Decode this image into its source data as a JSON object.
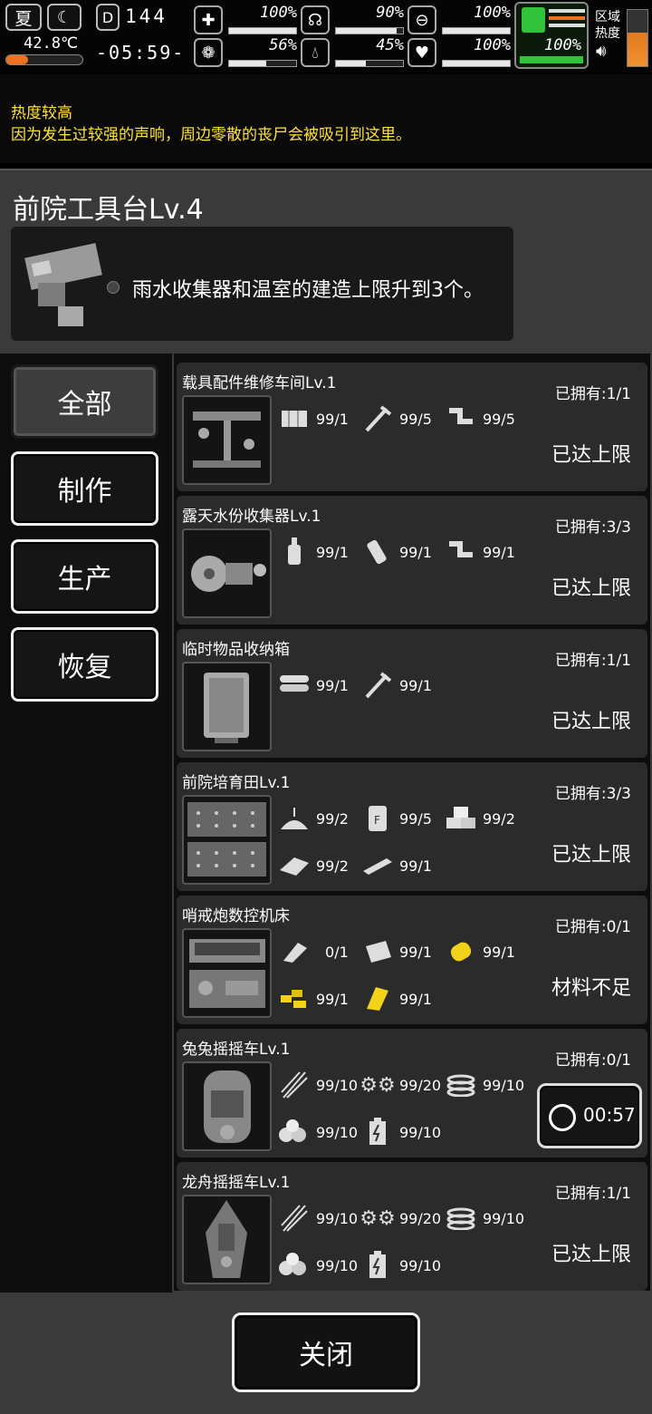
{
  "top": {
    "season": "夏",
    "temperature": "42.8℃",
    "day": "144",
    "clock": "-05:59-",
    "area_heat_label_1": "区域",
    "area_heat_label_2": "热度",
    "stats": [
      {
        "icon": "medkit-icon",
        "pct": "100%",
        "level": 1.0
      },
      {
        "icon": "stomach-icon",
        "pct": "90%",
        "level": 0.9
      },
      {
        "icon": "pill-icon",
        "pct": "100%",
        "level": 1.0
      },
      {
        "icon": "brain-icon",
        "pct": "56%",
        "level": 0.56
      },
      {
        "icon": "water-drop-icon",
        "pct": "45%",
        "level": 0.45
      },
      {
        "icon": "heart-icon",
        "pct": "100%",
        "level": 1.0
      },
      {
        "icon": "battery-icon",
        "pct": "100%",
        "level": 1.0
      }
    ]
  },
  "banner": {
    "title": "热度较高",
    "message": "因为发生过较强的声响，周边零散的丧尸会被吸引到这里。"
  },
  "panel": {
    "title": "前院工具台Lv.4",
    "info": "雨水收集器和温室的建造上限升到3个。"
  },
  "tabs": [
    "全部",
    "制作",
    "生产",
    "恢复"
  ],
  "items": [
    {
      "name": "载具配件维修车间Lv.1",
      "owned": "已拥有:1/1",
      "status": "已达上限",
      "mats": [
        {
          "icon": "wood-plank-icon",
          "have": "99",
          "need": "/1"
        },
        {
          "icon": "nail-icon",
          "have": "99",
          "need": "/5"
        },
        {
          "icon": "pipe-icon",
          "have": "99",
          "need": "/5"
        }
      ]
    },
    {
      "name": "露天水份收集器Lv.1",
      "owned": "已拥有:3/3",
      "status": "已达上限",
      "mats": [
        {
          "icon": "bottle-icon",
          "have": "99",
          "need": "/1"
        },
        {
          "icon": "tape-icon",
          "have": "99",
          "need": "/1"
        },
        {
          "icon": "pipe-icon",
          "have": "99",
          "need": "/1"
        }
      ]
    },
    {
      "name": "临时物品收纳箱",
      "owned": "已拥有:1/1",
      "status": "已达上限",
      "mats": [
        {
          "icon": "logs-icon",
          "have": "99",
          "need": "/1"
        },
        {
          "icon": "nail-icon",
          "have": "99",
          "need": "/1"
        }
      ]
    },
    {
      "name": "前院培育田Lv.1",
      "owned": "已拥有:3/3",
      "status": "已达上限",
      "mats": [
        {
          "icon": "soil-icon",
          "have": "99",
          "need": "/2"
        },
        {
          "icon": "fertilizer-icon",
          "have": "99",
          "need": "/5"
        },
        {
          "icon": "bricks-icon",
          "have": "99",
          "need": "/2"
        },
        {
          "icon": "cloth-icon",
          "have": "99",
          "need": "/2"
        },
        {
          "icon": "metal-sheet-icon",
          "have": "99",
          "need": "/1"
        }
      ]
    },
    {
      "name": "哨戒炮数控机床",
      "owned": "已拥有:0/1",
      "status": "材料不足",
      "mats": [
        {
          "icon": "part-icon",
          "have": "0",
          "need": "/1",
          "short": true
        },
        {
          "icon": "paper-icon",
          "have": "99",
          "need": "/1"
        },
        {
          "icon": "yellow-coil-icon",
          "have": "99",
          "need": "/1"
        },
        {
          "icon": "yellow-parts-icon",
          "have": "99",
          "need": "/1"
        },
        {
          "icon": "yellow-sheet-icon",
          "have": "99",
          "need": "/1"
        }
      ]
    },
    {
      "name": "兔兔摇摇车Lv.1",
      "owned": "已拥有:0/1",
      "timer": "00:57",
      "mats": [
        {
          "icon": "wires-icon",
          "have": "99",
          "need": "/10"
        },
        {
          "icon": "gears-icon",
          "have": "99",
          "need": "/20"
        },
        {
          "icon": "spring-icon",
          "have": "99",
          "need": "/10"
        },
        {
          "icon": "stones-icon",
          "have": "99",
          "need": "/10"
        },
        {
          "icon": "battery-cell-icon",
          "have": "99",
          "need": "/10"
        }
      ]
    },
    {
      "name": "龙舟摇摇车Lv.1",
      "owned": "已拥有:1/1",
      "status": "已达上限",
      "mats": [
        {
          "icon": "wires-icon",
          "have": "99",
          "need": "/10"
        },
        {
          "icon": "gears-icon",
          "have": "99",
          "need": "/20"
        },
        {
          "icon": "spring-icon",
          "have": "99",
          "need": "/10"
        },
        {
          "icon": "stones-icon",
          "have": "99",
          "need": "/10"
        },
        {
          "icon": "battery-cell-icon",
          "have": "99",
          "need": "/10"
        }
      ]
    }
  ],
  "close_label": "关闭"
}
